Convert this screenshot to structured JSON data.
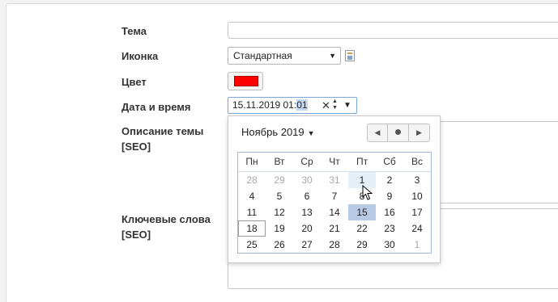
{
  "form": {
    "theme_label": "Тема",
    "theme_value": "",
    "icon_label": "Иконка",
    "icon_select_value": "Стандартная",
    "color_label": "Цвет",
    "color_value": "#ff0000",
    "datetime_label": "Дата и время",
    "datetime_value_main": "15.11.2019 01:",
    "datetime_value_selected": "01",
    "description_label_line1": "Описание темы",
    "description_label_line2": "[SEO]",
    "keywords_label_line1": "Ключевые слова",
    "keywords_label_line2": "[SEO]"
  },
  "calendar": {
    "month_label": "Ноябрь 2019",
    "weekdays": [
      "Пн",
      "Вт",
      "Ср",
      "Чт",
      "Пт",
      "Сб",
      "Вс"
    ],
    "weeks": [
      [
        "28",
        "29",
        "30",
        "31",
        "1",
        "2",
        "3"
      ],
      [
        "4",
        "5",
        "6",
        "7",
        "8",
        "9",
        "10"
      ],
      [
        "11",
        "12",
        "13",
        "14",
        "15",
        "16",
        "17"
      ],
      [
        "18",
        "19",
        "20",
        "21",
        "22",
        "23",
        "24"
      ],
      [
        "25",
        "26",
        "27",
        "28",
        "29",
        "30",
        "1"
      ]
    ],
    "selected_day": "15",
    "today_day": "1",
    "focused_day": "18"
  },
  "icons": {
    "dropdown_arrow": "chevron-down-icon",
    "file_icon": "file-icon",
    "clear_icon": "close-icon",
    "spinner_icon": "spinner-icon",
    "prev_icon": "chevron-left-icon",
    "today_icon": "dot-icon",
    "next_icon": "chevron-right-icon",
    "cursor": "mouse-cursor-icon"
  }
}
